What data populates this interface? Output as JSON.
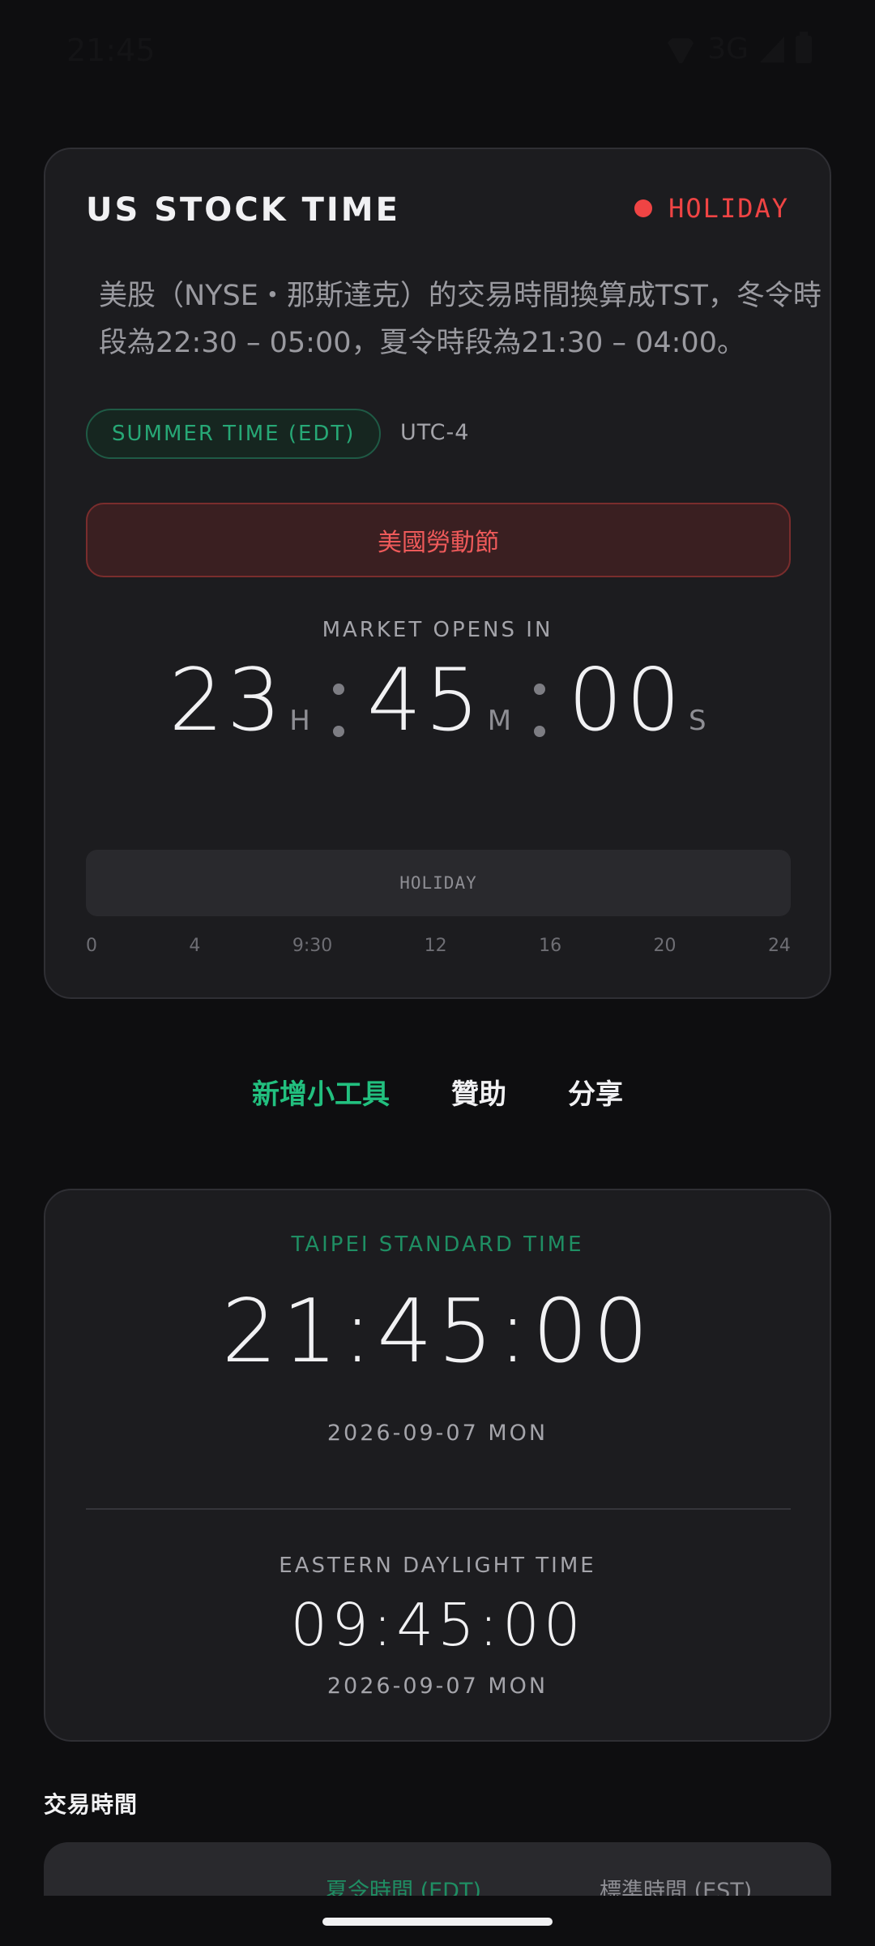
{
  "statusbar": {
    "time": "21:45",
    "network": "3G"
  },
  "stock_card": {
    "title": "US STOCK TIME",
    "status": "HOLIDAY",
    "description": "美股（NYSE・那斯達克）的交易時間換算成TST，冬令時段為22:30 – 05:00，夏令時段為21:30 – 04:00。",
    "season_pill": "SUMMER TIME (EDT)",
    "utc_offset": "UTC-4",
    "holiday_name": "美國勞動節",
    "countdown_label": "MARKET OPENS IN",
    "countdown": {
      "hours": "23",
      "hours_unit": "H",
      "minutes": "45",
      "minutes_unit": "M",
      "seconds": "00",
      "seconds_unit": "S"
    },
    "timeline_label": "HOLIDAY",
    "timeline_ticks": [
      "0",
      "4",
      "9:30",
      "12",
      "16",
      "20",
      "24"
    ]
  },
  "actions": {
    "add_widget": "新增小工具",
    "sponsor": "贊助",
    "share": "分享"
  },
  "time_card": {
    "tst_label": "TAIPEI STANDARD TIME",
    "tst_clock": "21:45:00",
    "tst_date": "2026-09-07 MON",
    "edt_label": "EASTERN DAYLIGHT TIME",
    "edt_clock": "09:45:00",
    "edt_date": "2026-09-07 MON"
  },
  "trading_hours": {
    "title": "交易時間",
    "col_summer": "夏令時間 (EDT)",
    "col_standard": "標準時間 (EST)"
  },
  "colors": {
    "accent_green": "#22c07f",
    "holiday_red": "#ef4444",
    "background": "#0e0e10",
    "card": "#1c1c1f"
  },
  "icons": [
    "wifi-icon",
    "signal-icon",
    "battery-icon",
    "status-dot-icon"
  ]
}
